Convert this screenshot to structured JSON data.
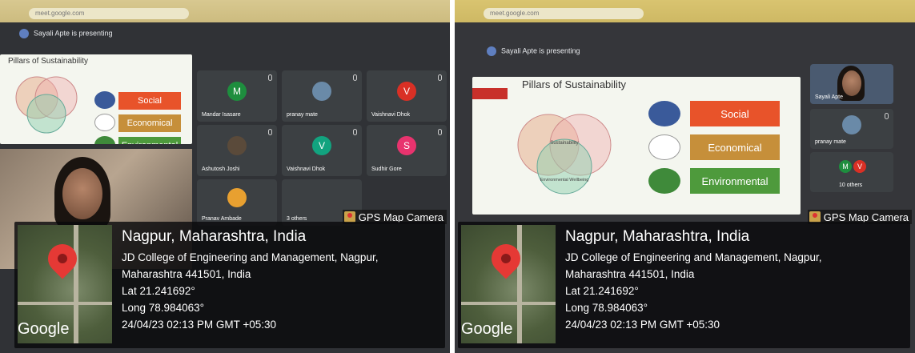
{
  "panels": [
    {
      "presenting_text": "Sayali Apte is presenting",
      "slide_title": "Pillars of Sustainability",
      "pillars": [
        "Social",
        "Economical",
        "Environmental"
      ],
      "tiles": [
        {
          "name": "Mandar Isasare",
          "initial": "M",
          "color": "#1e8e3e"
        },
        {
          "name": "pranay mate",
          "initial": "",
          "color": ""
        },
        {
          "name": "Vaishnavi Dhok",
          "initial": "V",
          "color": "#d93025"
        },
        {
          "name": "Ashutosh Joshi",
          "initial": "",
          "color": ""
        },
        {
          "name": "Vaishnavi Dhok",
          "initial": "V",
          "color": "#12a37f"
        },
        {
          "name": "Sudhir Gore",
          "initial": "S",
          "color": "#e8336e"
        },
        {
          "name": "Pranav Ambade",
          "initial": "",
          "color": ""
        },
        {
          "name": "3 others",
          "initial": "",
          "color": ""
        }
      ],
      "gps": {
        "badge": "GPS Map Camera",
        "place": "Nagpur, Maharashtra, India",
        "address_line1": "JD College of Engineering and Management, Nagpur,",
        "address_line2": "Maharashtra 441501, India",
        "lat": "Lat 21.241692°",
        "long": "Long 78.984063°",
        "datetime": "24/04/23 02:13 PM GMT +05:30",
        "map_brand": "Google"
      }
    },
    {
      "presenting_text": "Sayali Apte is presenting",
      "slide_title": "Pillars of Sustainability",
      "pillars": [
        "Social",
        "Economical",
        "Environmental"
      ],
      "venn_center": "Sustainability",
      "venn_bottom": "Environmental Wellbeing",
      "tiles": [
        {
          "name": "Sayali Apte",
          "initial": "",
          "color": ""
        },
        {
          "name": "pranay mate",
          "initial": "",
          "color": ""
        },
        {
          "name": "10 others",
          "initial": "M V",
          "color": ""
        }
      ],
      "gps": {
        "badge": "GPS Map Camera",
        "place": "Nagpur, Maharashtra, India",
        "address_line1": "JD College of Engineering and Management, Nagpur,",
        "address_line2": "Maharashtra 441501, India",
        "lat": "Lat 21.241692°",
        "long": "Long 78.984063°",
        "datetime": "24/04/23 02:13 PM GMT +05:30",
        "map_brand": "Google"
      }
    }
  ]
}
